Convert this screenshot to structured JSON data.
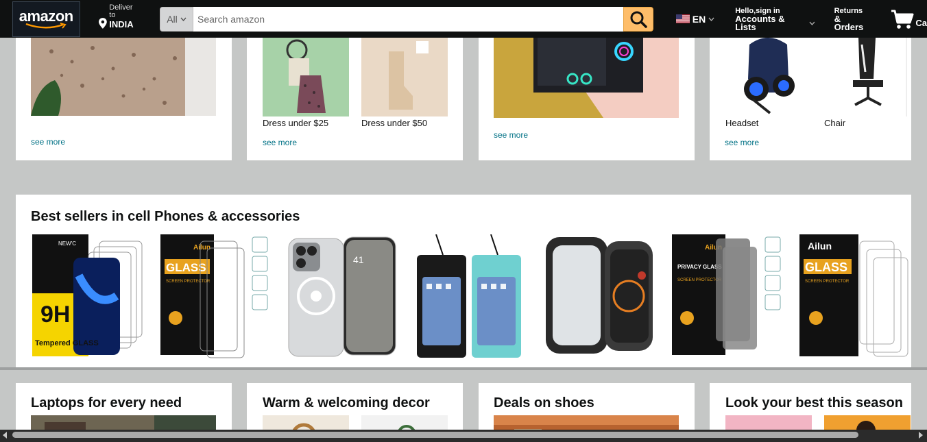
{
  "navbar": {
    "logo_text": "amazon",
    "deliver_label": "Deliver to",
    "deliver_location": "INDIA",
    "search_category": "All",
    "search_placeholder": "Search amazon",
    "language": "EN",
    "account_line1": "Hello,sign in",
    "account_line2": "Accounts & Lists",
    "returns_line1": "Returns",
    "returns_line2": "& Orders",
    "cart_label": "Ca"
  },
  "top_cards": [
    {
      "see_more": "see more"
    },
    {
      "items": [
        "Dress under $25",
        "Dress under $50"
      ],
      "see_more": "see more"
    },
    {
      "see_more": "see more"
    },
    {
      "items": [
        "Headset",
        "Chair"
      ],
      "see_more": "see more"
    }
  ],
  "bestsellers": {
    "title": "Best sellers in cell Phones & accessories",
    "products": [
      {
        "brand_text": "NEW'C",
        "label": "9H",
        "label2": "Tempered GLASS"
      },
      {
        "brand_text": "Ailun",
        "label": "GLASS",
        "label2": "SCREEN PROTECTOR"
      },
      {
        "brand_text": "",
        "label": "",
        "label2": ""
      },
      {
        "brand_text": "",
        "label": "",
        "label2": ""
      },
      {
        "brand_text": "",
        "label": "",
        "label2": ""
      },
      {
        "brand_text": "Ailun",
        "label": "PRIVACY GLASS",
        "label2": "SCREEN PROTECTOR"
      },
      {
        "brand_text": "Ailun",
        "label": "GLASS",
        "label2": "SCREEN PROTECTOR"
      }
    ]
  },
  "bottom_cards": [
    {
      "title": "Laptops for every need"
    },
    {
      "title": "Warm & welcoming decor"
    },
    {
      "title": "Deals on shoes"
    },
    {
      "title": "Look your best this season"
    }
  ],
  "colors": {
    "nav_bg": "#0f1111",
    "search_button": "#febd69",
    "link": "#007185",
    "page_bg": "#c5c7c6"
  },
  "icons": [
    "location-pin-icon",
    "search-icon",
    "us-flag-icon",
    "chevron-down-icon",
    "cart-icon"
  ]
}
